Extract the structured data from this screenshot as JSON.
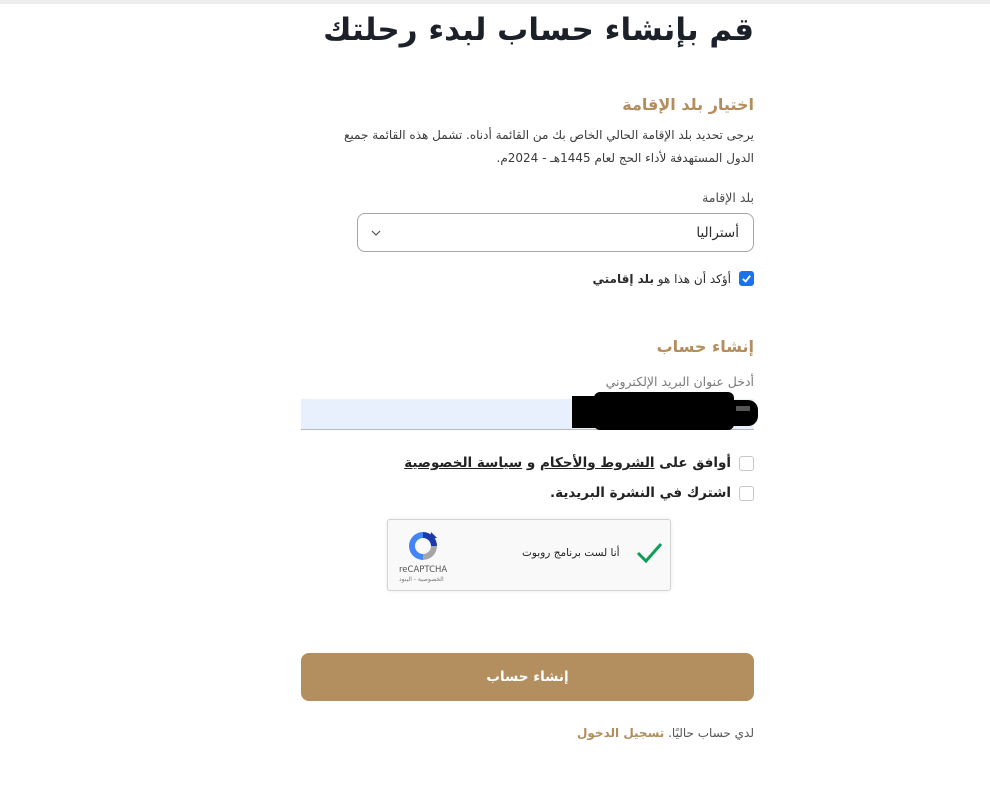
{
  "page": {
    "title": "قم بإنشاء حساب لبدء رحلتك"
  },
  "residence_section": {
    "heading": "اختيار بلد الإقامة",
    "description": "يرجى تحديد بلد الإقامة الحالي الخاص بك من القائمة أدناه. تشمل هذه القائمة جميع الدول المستهدفة لأداء الحج لعام 1445هـ - 2024م.",
    "country_label": "بلد الإقامة",
    "country_value": "أستراليا",
    "confirm_text": "أؤكد أن هذا هو ",
    "confirm_bold": "بلد إقامتي",
    "confirm_checked": true
  },
  "account_section": {
    "heading": "إنشاء حساب",
    "email_label": "أدخل عنوان البريد الإلكتروني",
    "terms_prefix": "أوافق على ",
    "terms_link": "الشروط والأحكام",
    "terms_and": " و ",
    "privacy_link": "سياسة الخصوصية",
    "newsletter_label": "اشترك في النشرة البريدية."
  },
  "recaptcha": {
    "label": "أنا لست برنامج روبوت",
    "brand": "reCAPTCHA",
    "footer_links": "الخصوصية - البنود"
  },
  "submit_label": "إنشاء حساب",
  "footer": {
    "text": "لدي حساب حاليًا. ",
    "login_link": "تسجيل الدخول"
  },
  "colors": {
    "accent_gold": "#b38e5f",
    "checkbox_blue": "#1a73e8",
    "autofill_bg": "#e8f0fe",
    "recaptcha_check_green": "#0f9d58"
  }
}
